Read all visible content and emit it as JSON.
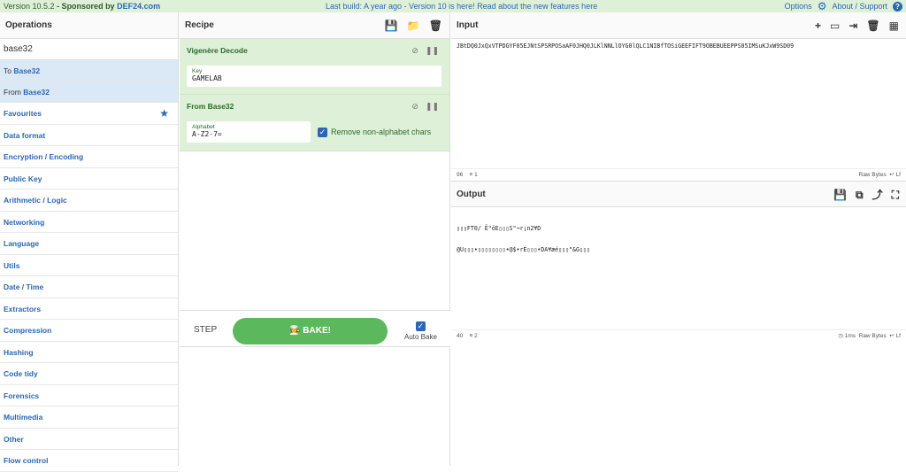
{
  "topbar": {
    "version": "Version 10.5.2",
    "sponsored": "- Sponsored by",
    "sponsor": "DEF24.com",
    "announcement": "Last build: A year ago - Version 10 is here! Read about the new features here",
    "options": "Options",
    "about": "About / Support"
  },
  "operations": {
    "title": "Operations",
    "search_value": "base32",
    "results": [
      {
        "prefix": "To ",
        "name": "Base32"
      },
      {
        "prefix": "From ",
        "name": "Base32"
      }
    ],
    "categories": [
      "Favourites",
      "Data format",
      "Encryption / Encoding",
      "Public Key",
      "Arithmetic / Logic",
      "Networking",
      "Language",
      "Utils",
      "Date / Time",
      "Extractors",
      "Compression",
      "Hashing",
      "Code tidy",
      "Forensics",
      "Multimedia",
      "Other",
      "Flow control"
    ]
  },
  "recipe": {
    "title": "Recipe",
    "ops": [
      {
        "title": "Vigenère Decode",
        "field_label": "Key",
        "field_value": "GAMELAB"
      },
      {
        "title": "From Base32",
        "field_label": "Alphabet",
        "field_value": "A-Z2-7=",
        "checkbox_label": "Remove non-alphabet chars"
      }
    ],
    "step": "STEP",
    "bake": "BAKE!",
    "auto_bake": "Auto Bake"
  },
  "input": {
    "title": "Input",
    "value": "JBtDQ0JxQxVTPDGYF05EJNtSPSRPOSaAF0JHQ0JLKlNNLlOYG0lQLC1NIBfTOSiGEEFIFT9OBEBUEEPPS05IMSuKJxW9SD09",
    "status_chars": "96",
    "status_lines": "1",
    "status_right": "Raw Bytes"
  },
  "output": {
    "title": "Output",
    "line1": "▯▯▯FT0/ Ë\"öE▯▯▯S\"¬r¡n2¥D",
    "line2": "@U▯▯▯•▯▯▯▯▯▯▯▯•@$•rÉ▯▯▯•DA¥æé▯▯▯\"&G▯▯▯",
    "status_chars": "40",
    "status_lines": "2",
    "status_time": "1ms",
    "status_right": "Raw Bytes"
  }
}
